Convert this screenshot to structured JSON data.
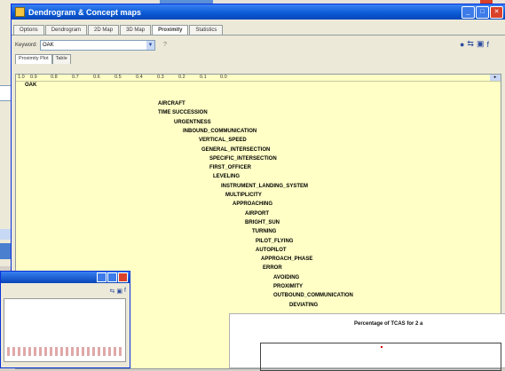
{
  "window": {
    "title": "Dendrogram & Concept maps"
  },
  "tabs": [
    {
      "label": "Options",
      "active": false
    },
    {
      "label": "Dendrogram",
      "active": false
    },
    {
      "label": "2D Map",
      "active": false
    },
    {
      "label": "3D Map",
      "active": false
    },
    {
      "label": "Proximity",
      "active": true
    },
    {
      "label": "Statistics",
      "active": false
    }
  ],
  "toolbar": {
    "keyword_label": "Keyword:",
    "keyword_value": "OAK",
    "help_glyph": "?"
  },
  "subtabs": [
    {
      "label": "Proximity Plot",
      "active": true
    },
    {
      "label": "Table",
      "active": false
    }
  ],
  "scale": [
    "1.0",
    "0.9",
    "0.8",
    "0.7",
    "0.6",
    "0.5",
    "0.4",
    "0.3",
    "0.2",
    "0.1",
    "0.0"
  ],
  "plot": {
    "root": "OAK",
    "terms": [
      "AIRCRAFT",
      "TIME SUCCESSION",
      "URGENTNESS",
      "INBOUND_COMMUNICATION",
      "VERTICAL_SPEED",
      "GENERAL_INTERSECTION",
      "SPECIFIC_INTERSECTION",
      "FIRST_OFFICER",
      "LEVELING",
      "INSTRUMENT_LANDING_SYSTEM",
      "MULTIPLICITY",
      "APPROACHING",
      "AIRPORT",
      "BRIGHT_SUN",
      "TURNING",
      "PILOT_FLYING",
      "AUTOPILOT",
      "APPROACH_PHASE",
      "ERROR",
      "AVOIDING",
      "PROXIMITY",
      "OUTBOUND_COMMUNICATION",
      "DEVIATING"
    ]
  },
  "chart_window": {
    "title": "Percentage of TCAS for 2 a"
  },
  "colors": {
    "title_bar": "#0a5ad4",
    "plot_background": "#ffffc6",
    "close_button": "#d9412a"
  }
}
